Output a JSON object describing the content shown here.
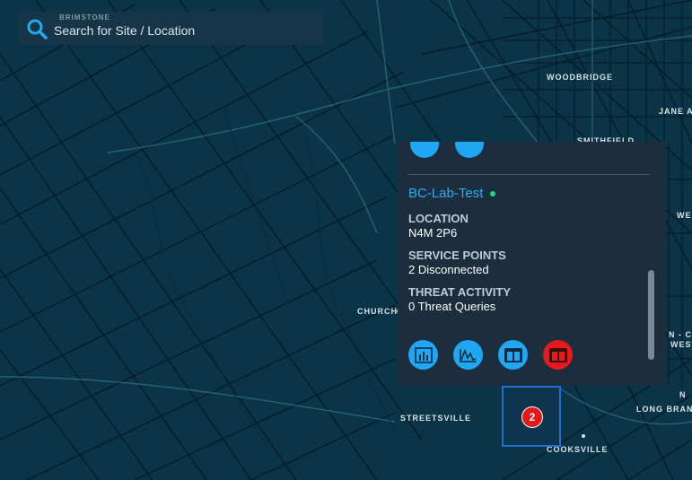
{
  "search": {
    "brand": "BRIMSTONE",
    "placeholder": "Search for Site / Location",
    "icon": "search-icon"
  },
  "map": {
    "places": [
      "WOODBRIDGE",
      "JANE A",
      "SMITHFIELD",
      "WE",
      "CHURCH",
      "N - CL",
      "WEST",
      "N",
      "LONG BRAN",
      "STREETSVILLE",
      "COOKSVILLE"
    ]
  },
  "popup": {
    "site_name": "BC-Lab-Test",
    "status": "online",
    "status_color": "#1fd38b",
    "location_label": "LOCATION",
    "location_value": "N4M 2P6",
    "service_label": "SERVICE POINTS",
    "service_value": "2 Disconnected",
    "threat_label": "THREAT ACTIVITY",
    "threat_value": "0 Threat Queries",
    "actions": [
      {
        "icon": "bar-chart-icon",
        "color": "#20a7f4"
      },
      {
        "icon": "line-chart-icon",
        "color": "#20a7f4"
      },
      {
        "icon": "panels-icon",
        "color": "#20a7f4"
      },
      {
        "icon": "panels-icon",
        "color": "#e8191c"
      }
    ]
  },
  "cluster": {
    "count": "2",
    "color": "#e2181b"
  }
}
